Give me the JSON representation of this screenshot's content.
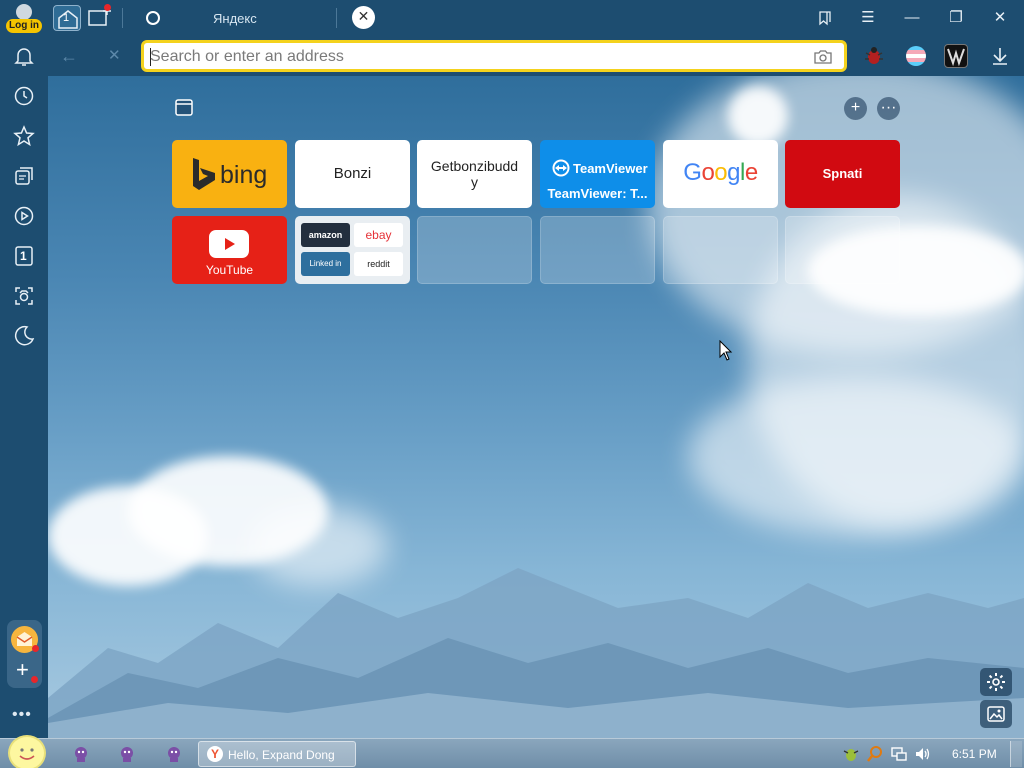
{
  "titlebar": {
    "login_label": "Log in",
    "home_tab_count": "1",
    "tab_title": "Яндекс"
  },
  "address_bar": {
    "placeholder": "Search or enter an address",
    "value": ""
  },
  "sidebar": {
    "items": [
      {
        "name": "notifications",
        "icon": "bell-icon"
      },
      {
        "name": "history",
        "icon": "clock-icon"
      },
      {
        "name": "bookmarks",
        "icon": "star-icon"
      },
      {
        "name": "collections",
        "icon": "collections-icon"
      },
      {
        "name": "media",
        "icon": "play-icon"
      },
      {
        "name": "tabs",
        "icon": "tab-count-icon",
        "label": "1"
      },
      {
        "name": "screenshot",
        "icon": "camera-icon"
      },
      {
        "name": "dark-mode",
        "icon": "moon-icon"
      }
    ],
    "more_label": "•••"
  },
  "page_controls": {
    "add_label": "+",
    "more_label": "···"
  },
  "speed_dial": [
    {
      "name": "bing",
      "label": "bing",
      "bg": "#f9b111"
    },
    {
      "name": "bonzi",
      "label": "Bonzi",
      "bg": "#ffffff"
    },
    {
      "name": "getbonzibuddy",
      "label": "Getbonzibudd y",
      "bg": "#ffffff"
    },
    {
      "name": "teamviewer",
      "label": "TeamViewer: T...",
      "logo": "TeamViewer",
      "bg": "#0e8ee9"
    },
    {
      "name": "google",
      "label": "Google",
      "bg": "#ffffff"
    },
    {
      "name": "spnati",
      "label": "Spnati",
      "bg": "#d10a11"
    },
    {
      "name": "youtube",
      "label": "YouTube",
      "bg": "#e62117"
    },
    {
      "name": "shops-folder",
      "items": [
        "amazon",
        "ebay",
        "Linked in",
        "reddit"
      ],
      "bg": "#e9eef2"
    },
    {
      "name": "empty-1"
    },
    {
      "name": "empty-2"
    },
    {
      "name": "empty-3"
    },
    {
      "name": "empty-4"
    }
  ],
  "taskbar": {
    "task_label": "Hello, Expand Dong",
    "clock": "6:51 PM"
  },
  "colors": {
    "chrome": "#1d4d70",
    "accent": "#f4d21d"
  }
}
